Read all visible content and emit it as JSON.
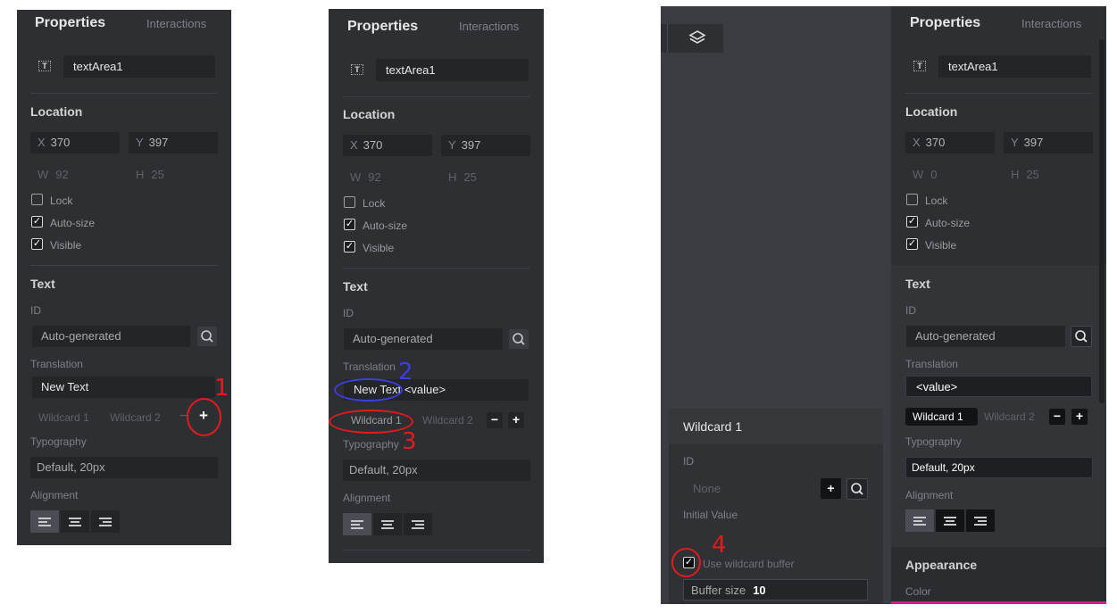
{
  "panel1": {
    "header": {
      "title": "Properties",
      "tab": "Interactions"
    },
    "name": "textArea1",
    "location": {
      "title": "Location",
      "x_label": "X",
      "x_value": "370",
      "y_label": "Y",
      "y_value": "397",
      "w_label": "W",
      "w_value": "92",
      "h_label": "H",
      "h_value": "25",
      "lock": "Lock",
      "autosize": "Auto-size",
      "visible": "Visible"
    },
    "text": {
      "title": "Text",
      "id_label": "ID",
      "id_placeholder": "Auto-generated",
      "translation_label": "Translation",
      "translation_value": "New Text",
      "wildcard1": "Wildcard 1",
      "wildcard2": "Wildcard 2",
      "minus": "−",
      "plus": "+",
      "typography_label": "Typography",
      "typography_value": "Default, 20px",
      "alignment_label": "Alignment"
    },
    "annotation": "1"
  },
  "panel2": {
    "header": {
      "title": "Properties",
      "tab": "Interactions"
    },
    "name": "textArea1",
    "location": {
      "title": "Location",
      "x_label": "X",
      "x_value": "370",
      "y_label": "Y",
      "y_value": "397",
      "w_label": "W",
      "w_value": "92",
      "h_label": "H",
      "h_value": "25",
      "lock": "Lock",
      "autosize": "Auto-size",
      "visible": "Visible"
    },
    "text": {
      "title": "Text",
      "id_label": "ID",
      "id_placeholder": "Auto-generated",
      "translation_label": "Translation",
      "translation_value": "New Text <value>",
      "wildcard1": "Wildcard 1",
      "wildcard2": "Wildcard 2",
      "minus": "−",
      "plus": "+",
      "typography_label": "Typography",
      "typography_value": "Default, 20px",
      "alignment_label": "Alignment"
    },
    "annotations": {
      "two": "2",
      "three": "3"
    }
  },
  "panel3": {
    "header": {
      "title": "Properties",
      "tab": "Interactions"
    },
    "name": "textArea1",
    "location": {
      "title": "Location",
      "x_label": "X",
      "x_value": "370",
      "y_label": "Y",
      "y_value": "397",
      "w_label": "W",
      "w_value": "0",
      "h_label": "H",
      "h_value": "25",
      "lock": "Lock",
      "autosize": "Auto-size",
      "visible": "Visible"
    },
    "text": {
      "title": "Text",
      "id_label": "ID",
      "id_placeholder": "Auto-generated",
      "translation_label": "Translation",
      "translation_value": "<value>",
      "wildcard1": "Wildcard 1",
      "wildcard2": "Wildcard 2",
      "minus": "−",
      "plus": "+",
      "typography_label": "Typography",
      "typography_value": "Default, 20px",
      "alignment_label": "Alignment"
    },
    "appearance": {
      "title": "Appearance",
      "color_label": "Color"
    },
    "wildcard_popup": {
      "title": "Wildcard 1",
      "id_label": "ID",
      "id_placeholder": "None",
      "initial_value_label": "Initial Value",
      "use_buffer_label": "Use wildcard buffer",
      "buffer_size_label": "Buffer size",
      "buffer_size_value": "10",
      "plus": "+"
    },
    "annotation": "4"
  },
  "colors": {
    "panel_bg": "#2d2f33",
    "canvas_bg": "#3a3c41",
    "annotation_red": "#e01c1c",
    "annotation_blue": "#3b3fe0",
    "accent_pink": "#e0158c"
  },
  "icons": [
    "text-type-icon",
    "search-icon",
    "plus-icon",
    "minus-icon",
    "align-left-icon",
    "align-center-icon",
    "align-right-icon",
    "layers-icon",
    "checkmark-icon"
  ]
}
